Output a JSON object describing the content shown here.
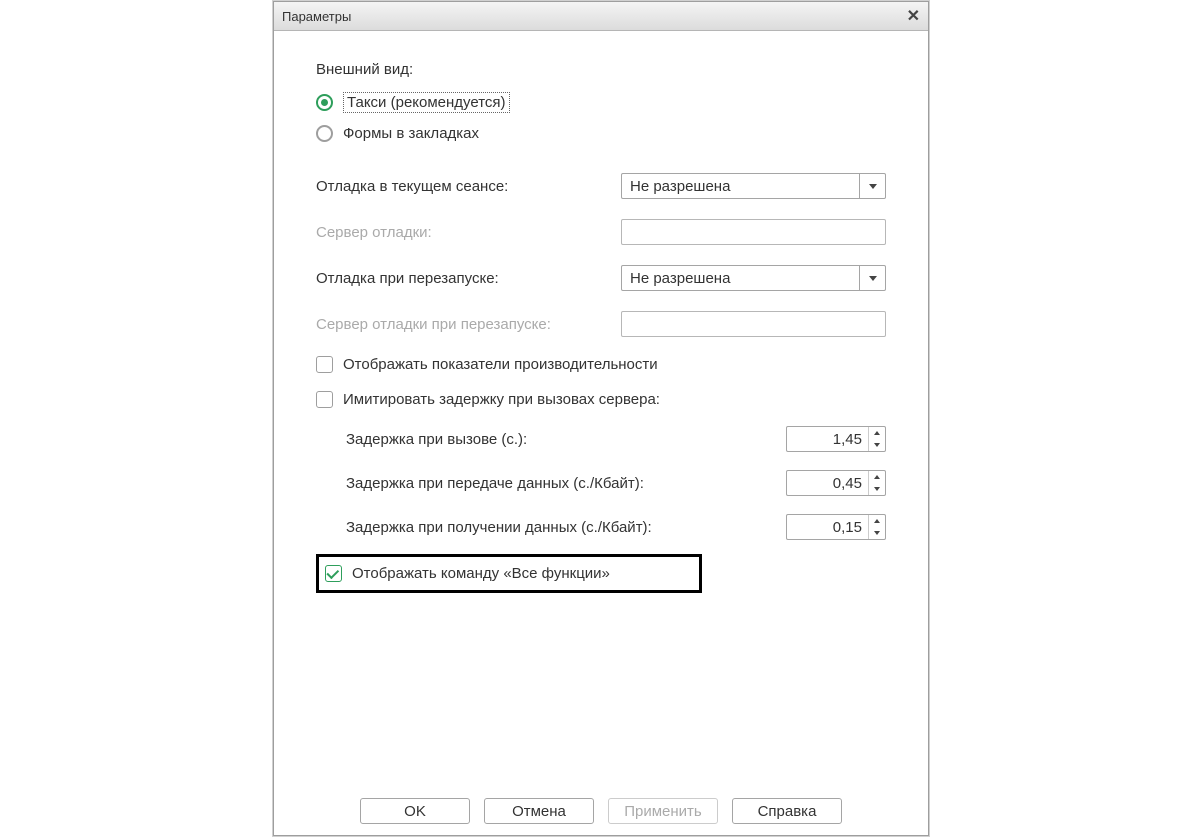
{
  "window": {
    "title": "Параметры"
  },
  "section": {
    "appearance_label": "Внешний вид:"
  },
  "radios": {
    "taxi_label": "Такси (рекомендуется)",
    "forms_label": "Формы в закладках"
  },
  "fields": {
    "debug_current_label": "Отладка в текущем сеансе:",
    "debug_current_value": "Не разрешена",
    "debug_server_label": "Сервер отладки:",
    "debug_server_value": "",
    "debug_restart_label": "Отладка при перезапуске:",
    "debug_restart_value": "Не разрешена",
    "debug_server_restart_label": "Сервер отладки при перезапуске:",
    "debug_server_restart_value": ""
  },
  "checks": {
    "perf_label": "Отображать показатели производительности",
    "imitate_label": "Имитировать задержку при вызовах сервера:",
    "allfunc_label": "Отображать команду «Все функции»"
  },
  "delays": {
    "call_label": "Задержка при вызове (с.):",
    "call_value": "1,45",
    "send_label": "Задержка при передаче данных (с./Кбайт):",
    "send_value": "0,45",
    "recv_label": "Задержка при получении данных (с./Кбайт):",
    "recv_value": "0,15"
  },
  "buttons": {
    "ok": "OK",
    "cancel": "Отмена",
    "apply": "Применить",
    "help": "Справка"
  }
}
